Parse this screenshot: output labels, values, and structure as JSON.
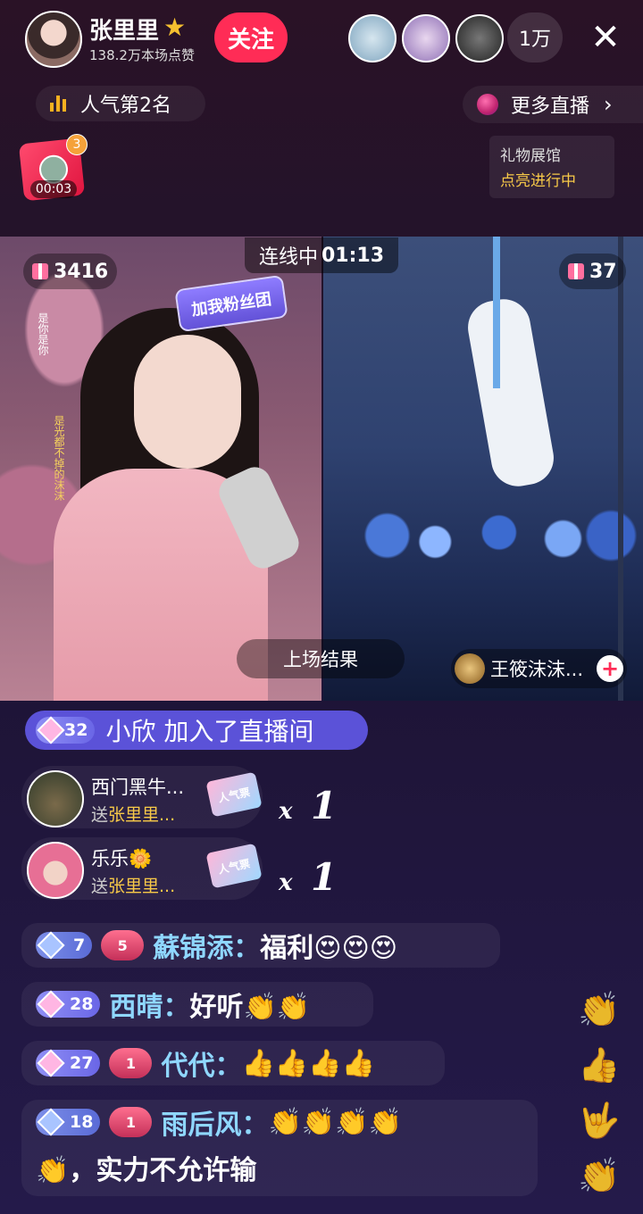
{
  "header": {
    "host_name": "张里里",
    "host_likes": "138.2万本场点赞",
    "follow_label": "关注",
    "viewer_count": "1万",
    "close_label": "✕"
  },
  "rank": {
    "label": "人气第2名"
  },
  "more_live": {
    "label": "更多直播",
    "chevron": "›"
  },
  "gift_gallery": {
    "title": "礼物展馆",
    "status": "点亮进行中"
  },
  "red_packet": {
    "badge": "3",
    "timer": "00:03"
  },
  "linkmic": {
    "status_label": "连线中",
    "status_time": "01:13",
    "left_gifts": "3416",
    "right_gifts": "37",
    "result_label": "上场结果",
    "opponent_name": "王筱沫沫...",
    "fan_badge": "加我粉丝团",
    "overlay_text_1": "是你是你",
    "overlay_text_2": "是光都不掉的沫沫"
  },
  "join_notice": {
    "level": "32",
    "text": "小欣 加入了直播间"
  },
  "gift_messages": [
    {
      "name": "西门黑牛...",
      "to": "送",
      "target": "张里里...",
      "gift": "人气票",
      "mult_x": "x",
      "mult_n": "1"
    },
    {
      "name": "乐乐🌼",
      "to": "送",
      "target": "张里里...",
      "gift": "人气票",
      "mult_x": "x",
      "mult_n": "1"
    }
  ],
  "chat": [
    {
      "level": "7",
      "heart": "5",
      "name": "蘇锦添：",
      "text": "福利😍😍😍"
    },
    {
      "level": "28",
      "heart": "",
      "name": "西晴：",
      "text": "好听👏👏"
    },
    {
      "level": "27",
      "heart": "1",
      "name": "代代：",
      "text": "👍👍👍👍"
    },
    {
      "level": "18",
      "heart": "1",
      "name": "雨后风：",
      "text": "👏👏👏👏",
      "text2": "👏，实力不允许输"
    }
  ],
  "icons": [
    "star-icon",
    "bar-chart-icon",
    "gem-icon",
    "gift-icon",
    "plus-icon",
    "close-icon",
    "clap-icon",
    "thumbs-up-icon"
  ],
  "colors": {
    "follow": "#ff2c56",
    "join_pill": "#5b52d8",
    "name_blue": "#8fd7ff",
    "gold": "#f7c948"
  }
}
